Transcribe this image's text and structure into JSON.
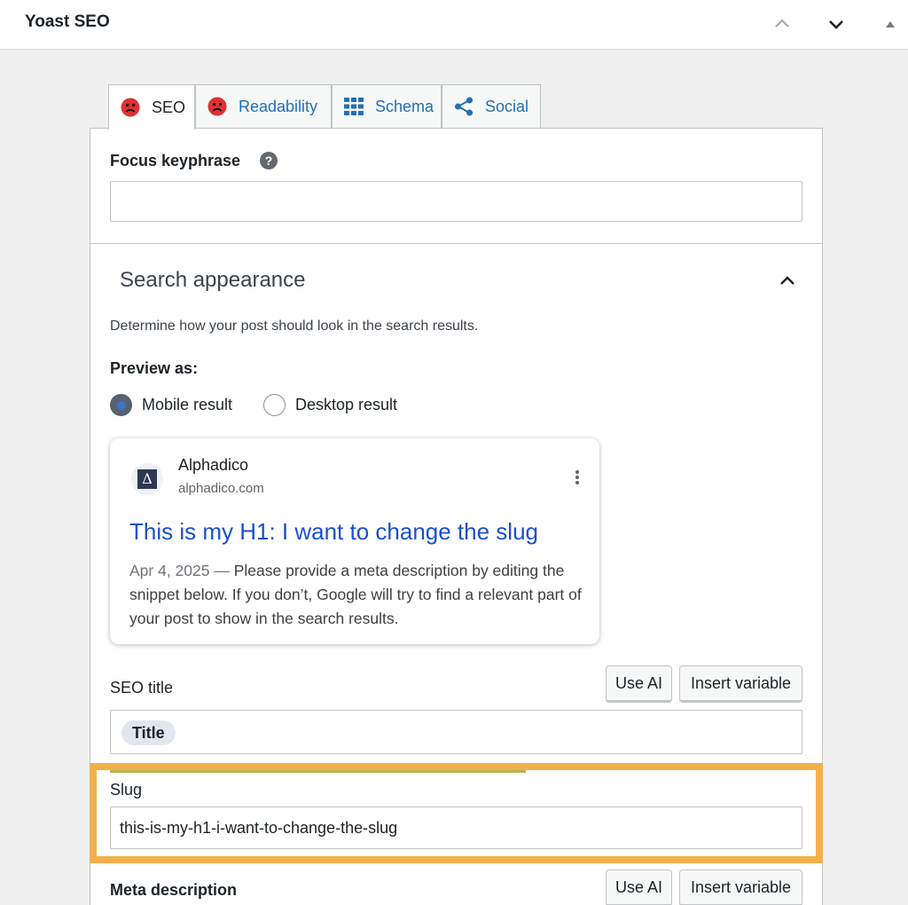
{
  "header": {
    "title": "Yoast SEO"
  },
  "tabs": [
    {
      "label": "SEO"
    },
    {
      "label": "Readability"
    },
    {
      "label": "Schema"
    },
    {
      "label": "Social"
    }
  ],
  "focus_keyphrase": {
    "label": "Focus keyphrase",
    "help_glyph": "?",
    "value": ""
  },
  "search_appearance": {
    "heading": "Search appearance",
    "description": "Determine how your post should look in the search results.",
    "preview_as_label": "Preview as:",
    "options": [
      {
        "label": "Mobile result",
        "selected": true
      },
      {
        "label": "Desktop result",
        "selected": false
      }
    ]
  },
  "snippet": {
    "favicon_glyph": "Δ",
    "site_name": "Alphadico",
    "site_url": "alphadico.com",
    "title": "This is my H1: I want to change the slug",
    "date": "Apr 4, 2025",
    "separator": "—",
    "description": "Please provide a meta description by editing the snippet below. If you don’t, Google will try to find a relevant part of your post to show in the search results."
  },
  "seo_title": {
    "label": "SEO title",
    "use_ai_label": "Use AI",
    "insert_variable_label": "Insert variable",
    "chip": "Title"
  },
  "slug": {
    "label": "Slug",
    "value": "this-is-my-h1-i-want-to-change-the-slug"
  },
  "meta_description": {
    "label": "Meta description",
    "use_ai_label": "Use AI",
    "insert_variable_label": "Insert variable"
  },
  "title_progress": 0.6,
  "colors": {
    "accent_highlight": "#f2b04d",
    "link": "#2271b1",
    "problem_face": "#dc3232",
    "snippet_title": "#1a4fd1"
  },
  "icons": {
    "sad_face": "sad-face-icon",
    "grid": "grid-icon",
    "share": "share-icon",
    "chevron_up": "chevron-up-icon",
    "chevron_down": "chevron-down-icon",
    "triangle_up": "triangle-up-icon"
  }
}
